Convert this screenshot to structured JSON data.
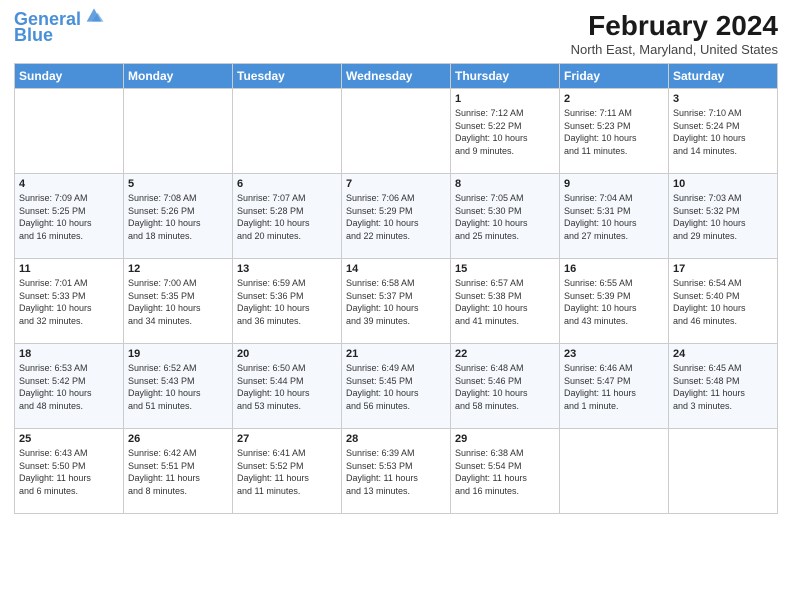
{
  "header": {
    "logo_line1": "General",
    "logo_line2": "Blue",
    "month_title": "February 2024",
    "location": "North East, Maryland, United States"
  },
  "days_of_week": [
    "Sunday",
    "Monday",
    "Tuesday",
    "Wednesday",
    "Thursday",
    "Friday",
    "Saturday"
  ],
  "weeks": [
    [
      {
        "day": "",
        "info": ""
      },
      {
        "day": "",
        "info": ""
      },
      {
        "day": "",
        "info": ""
      },
      {
        "day": "",
        "info": ""
      },
      {
        "day": "1",
        "info": "Sunrise: 7:12 AM\nSunset: 5:22 PM\nDaylight: 10 hours\nand 9 minutes."
      },
      {
        "day": "2",
        "info": "Sunrise: 7:11 AM\nSunset: 5:23 PM\nDaylight: 10 hours\nand 11 minutes."
      },
      {
        "day": "3",
        "info": "Sunrise: 7:10 AM\nSunset: 5:24 PM\nDaylight: 10 hours\nand 14 minutes."
      }
    ],
    [
      {
        "day": "4",
        "info": "Sunrise: 7:09 AM\nSunset: 5:25 PM\nDaylight: 10 hours\nand 16 minutes."
      },
      {
        "day": "5",
        "info": "Sunrise: 7:08 AM\nSunset: 5:26 PM\nDaylight: 10 hours\nand 18 minutes."
      },
      {
        "day": "6",
        "info": "Sunrise: 7:07 AM\nSunset: 5:28 PM\nDaylight: 10 hours\nand 20 minutes."
      },
      {
        "day": "7",
        "info": "Sunrise: 7:06 AM\nSunset: 5:29 PM\nDaylight: 10 hours\nand 22 minutes."
      },
      {
        "day": "8",
        "info": "Sunrise: 7:05 AM\nSunset: 5:30 PM\nDaylight: 10 hours\nand 25 minutes."
      },
      {
        "day": "9",
        "info": "Sunrise: 7:04 AM\nSunset: 5:31 PM\nDaylight: 10 hours\nand 27 minutes."
      },
      {
        "day": "10",
        "info": "Sunrise: 7:03 AM\nSunset: 5:32 PM\nDaylight: 10 hours\nand 29 minutes."
      }
    ],
    [
      {
        "day": "11",
        "info": "Sunrise: 7:01 AM\nSunset: 5:33 PM\nDaylight: 10 hours\nand 32 minutes."
      },
      {
        "day": "12",
        "info": "Sunrise: 7:00 AM\nSunset: 5:35 PM\nDaylight: 10 hours\nand 34 minutes."
      },
      {
        "day": "13",
        "info": "Sunrise: 6:59 AM\nSunset: 5:36 PM\nDaylight: 10 hours\nand 36 minutes."
      },
      {
        "day": "14",
        "info": "Sunrise: 6:58 AM\nSunset: 5:37 PM\nDaylight: 10 hours\nand 39 minutes."
      },
      {
        "day": "15",
        "info": "Sunrise: 6:57 AM\nSunset: 5:38 PM\nDaylight: 10 hours\nand 41 minutes."
      },
      {
        "day": "16",
        "info": "Sunrise: 6:55 AM\nSunset: 5:39 PM\nDaylight: 10 hours\nand 43 minutes."
      },
      {
        "day": "17",
        "info": "Sunrise: 6:54 AM\nSunset: 5:40 PM\nDaylight: 10 hours\nand 46 minutes."
      }
    ],
    [
      {
        "day": "18",
        "info": "Sunrise: 6:53 AM\nSunset: 5:42 PM\nDaylight: 10 hours\nand 48 minutes."
      },
      {
        "day": "19",
        "info": "Sunrise: 6:52 AM\nSunset: 5:43 PM\nDaylight: 10 hours\nand 51 minutes."
      },
      {
        "day": "20",
        "info": "Sunrise: 6:50 AM\nSunset: 5:44 PM\nDaylight: 10 hours\nand 53 minutes."
      },
      {
        "day": "21",
        "info": "Sunrise: 6:49 AM\nSunset: 5:45 PM\nDaylight: 10 hours\nand 56 minutes."
      },
      {
        "day": "22",
        "info": "Sunrise: 6:48 AM\nSunset: 5:46 PM\nDaylight: 10 hours\nand 58 minutes."
      },
      {
        "day": "23",
        "info": "Sunrise: 6:46 AM\nSunset: 5:47 PM\nDaylight: 11 hours\nand 1 minute."
      },
      {
        "day": "24",
        "info": "Sunrise: 6:45 AM\nSunset: 5:48 PM\nDaylight: 11 hours\nand 3 minutes."
      }
    ],
    [
      {
        "day": "25",
        "info": "Sunrise: 6:43 AM\nSunset: 5:50 PM\nDaylight: 11 hours\nand 6 minutes."
      },
      {
        "day": "26",
        "info": "Sunrise: 6:42 AM\nSunset: 5:51 PM\nDaylight: 11 hours\nand 8 minutes."
      },
      {
        "day": "27",
        "info": "Sunrise: 6:41 AM\nSunset: 5:52 PM\nDaylight: 11 hours\nand 11 minutes."
      },
      {
        "day": "28",
        "info": "Sunrise: 6:39 AM\nSunset: 5:53 PM\nDaylight: 11 hours\nand 13 minutes."
      },
      {
        "day": "29",
        "info": "Sunrise: 6:38 AM\nSunset: 5:54 PM\nDaylight: 11 hours\nand 16 minutes."
      },
      {
        "day": "",
        "info": ""
      },
      {
        "day": "",
        "info": ""
      }
    ]
  ]
}
